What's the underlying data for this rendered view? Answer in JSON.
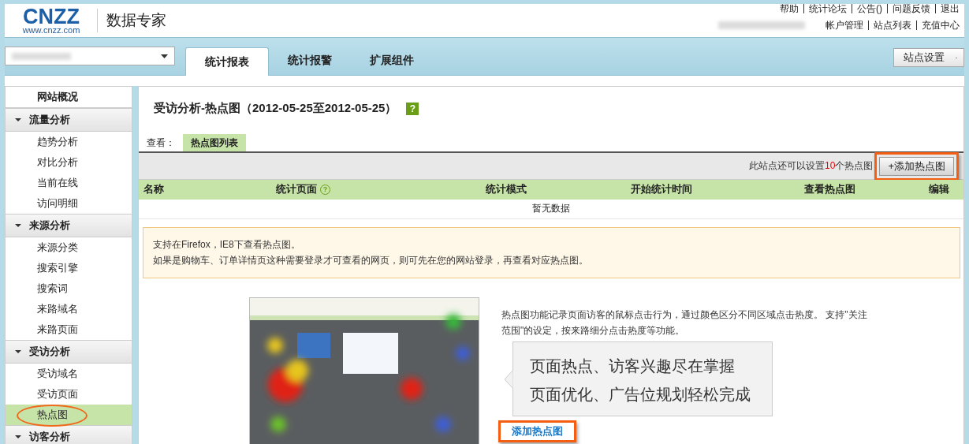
{
  "header": {
    "logo": {
      "wordmark": "CNZZ",
      "domain": "www.cnzz.com"
    },
    "product": "数据专家",
    "top_links": [
      "帮助",
      "统计论坛",
      "公告()",
      "问题反馈",
      "退出"
    ],
    "account_links": [
      "帐户管理",
      "站点列表",
      "充值中心"
    ]
  },
  "nav": {
    "tabs": [
      {
        "label": "统计报表",
        "selected": true
      },
      {
        "label": "统计报警",
        "selected": false
      },
      {
        "label": "扩展组件",
        "selected": false
      }
    ],
    "site_settings": "站点设置"
  },
  "sidebar": [
    {
      "label": "网站概况",
      "kind": "link",
      "selected": false
    },
    {
      "label": "流量分析",
      "kind": "group",
      "expanded": true,
      "children": [
        {
          "label": "趋势分析",
          "selected": false
        },
        {
          "label": "对比分析",
          "selected": false
        },
        {
          "label": "当前在线",
          "selected": false
        },
        {
          "label": "访问明细",
          "selected": false
        }
      ]
    },
    {
      "label": "来源分析",
      "kind": "group",
      "expanded": true,
      "children": [
        {
          "label": "来源分类",
          "selected": false
        },
        {
          "label": "搜索引擎",
          "selected": false
        },
        {
          "label": "搜索词",
          "selected": false
        },
        {
          "label": "来路域名",
          "selected": false
        },
        {
          "label": "来路页面",
          "selected": false
        }
      ]
    },
    {
      "label": "受访分析",
      "kind": "group",
      "expanded": true,
      "children": [
        {
          "label": "受访域名",
          "selected": false
        },
        {
          "label": "受访页面",
          "selected": false
        },
        {
          "label": "热点图",
          "selected": true,
          "highlighted": true
        }
      ]
    },
    {
      "label": "访客分析",
      "kind": "group",
      "expanded": true
    }
  ],
  "page": {
    "title": "受访分析-热点图（2012-05-25至2012-05-25）",
    "title_help": "?",
    "view_label": "查看：",
    "view_tabs": [
      {
        "label": "热点图列表",
        "selected": true
      }
    ],
    "quota": {
      "prefix": "此站点还可以设置",
      "count": "10",
      "suffix": "个热点图"
    },
    "add_button": {
      "label": "+添加热点图",
      "highlighted": true
    },
    "table": {
      "columns": [
        {
          "label": "名称"
        },
        {
          "label": "统计页面",
          "help": "?"
        },
        {
          "label": "统计模式"
        },
        {
          "label": "开始统计时间"
        },
        {
          "label": "查看热点图"
        },
        {
          "label": "编辑"
        }
      ],
      "empty_text": "暂无数据"
    },
    "notice": [
      "支持在Firefox，IE8下查看热点图。",
      "如果是购物车、订单详情页这种需要登录才可查看的网页，则可先在您的网站登录，再查看对应热点图。"
    ],
    "intro": {
      "picture": {
        "kind": "picture"
      },
      "description": "热点图功能记录页面访客的鼠标点击行为，通过颜色区分不同区域点击热度。 支持\"关注范围\"的设定，按来路细分点击热度等功能。",
      "callout": [
        "页面热点、访客兴趣尽在掌握",
        "页面优化、广告位规划轻松完成"
      ],
      "link": {
        "label": "添加热点图",
        "highlighted": true
      }
    }
  }
}
